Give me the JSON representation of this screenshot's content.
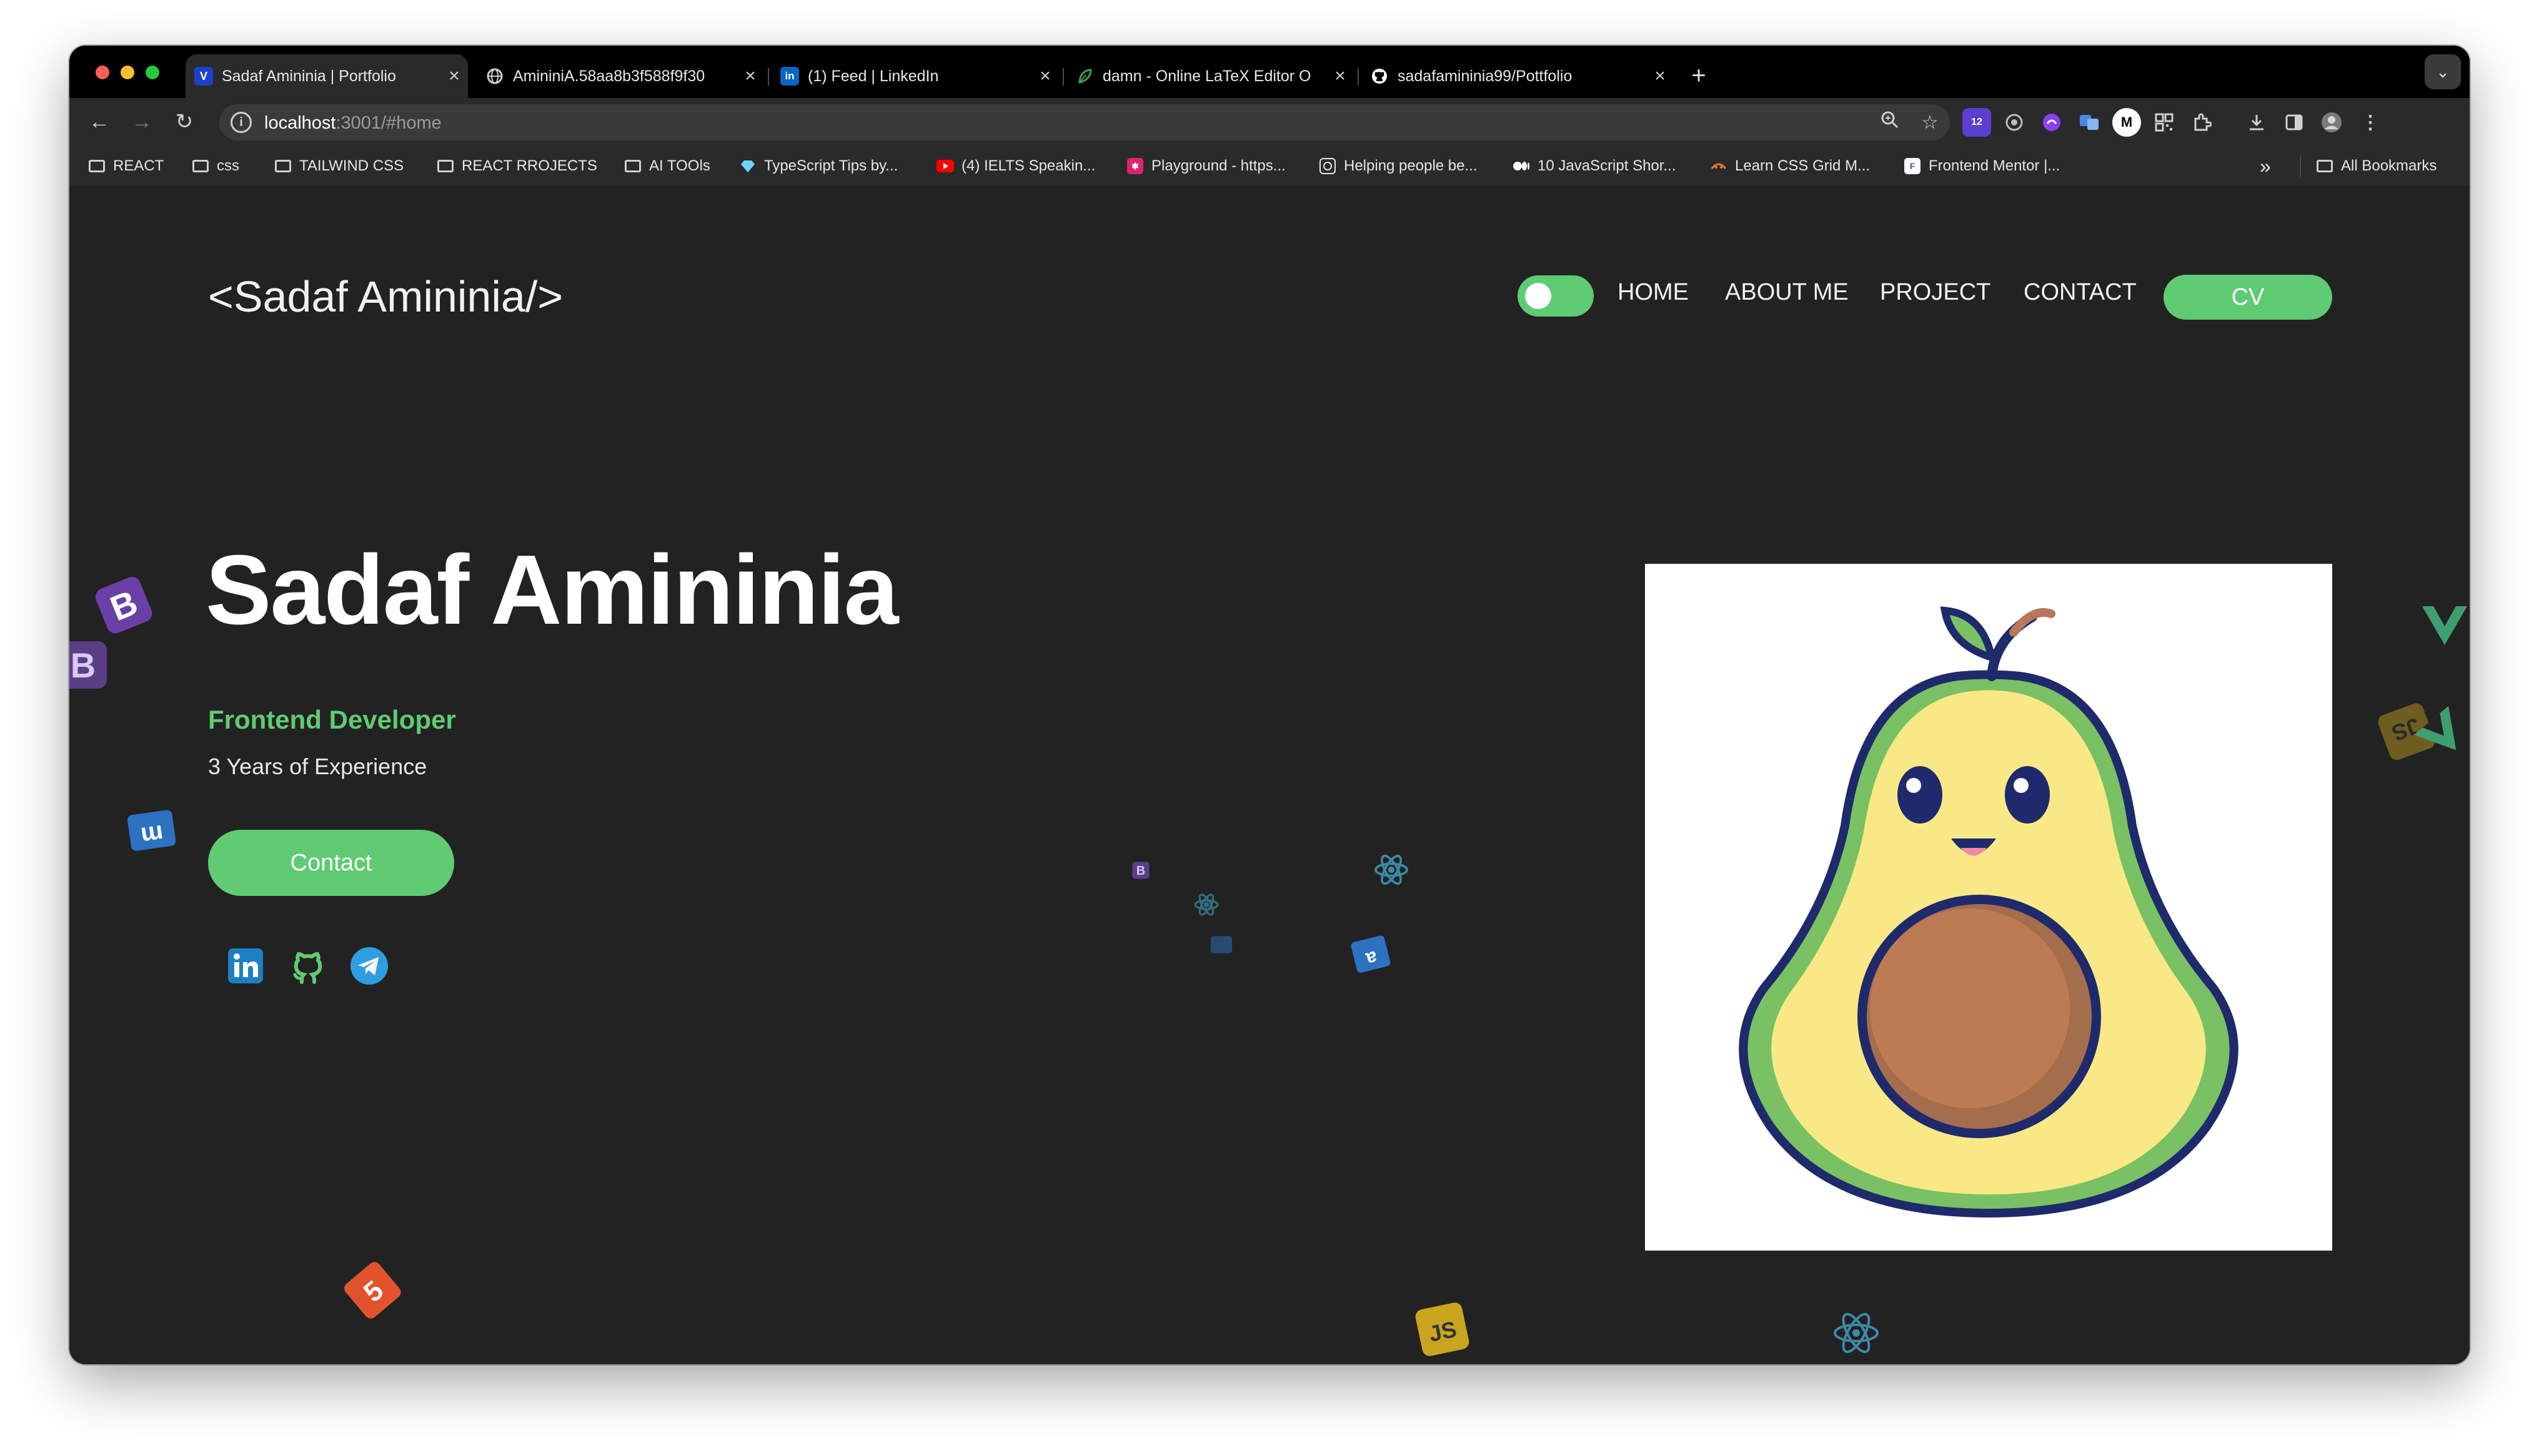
{
  "browser": {
    "tabs": [
      {
        "title": "Sadaf Amininia | Portfolio",
        "favicon": "V",
        "favicon_color": "#1e40c8",
        "active": true
      },
      {
        "title": "AmininiA.58aa8b3f588f9f30",
        "favicon": "globe-icon",
        "favicon_color": "#888888",
        "active": false
      },
      {
        "title": "(1) Feed | LinkedIn",
        "favicon": "in",
        "favicon_color": "#0a66c2",
        "active": false
      },
      {
        "title": "damn - Online LaTeX Editor O",
        "favicon": "leaf-icon",
        "favicon_color": "#3fa34d",
        "active": false
      },
      {
        "title": "sadafamininia99/Pottfolio",
        "favicon": "github-icon",
        "favicon_color": "#ffffff",
        "active": false
      }
    ],
    "url_host": "localhost",
    "url_path": ":3001/#home",
    "extension_badge": "12",
    "bookmarks": [
      {
        "label": "REACT",
        "icon": "folder-icon"
      },
      {
        "label": "css",
        "icon": "folder-icon"
      },
      {
        "label": "TAILWIND CSS",
        "icon": "folder-icon"
      },
      {
        "label": "REACT RROJECTS",
        "icon": "folder-icon"
      },
      {
        "label": "AI TOOls",
        "icon": "folder-icon"
      },
      {
        "label": "TypeScript Tips by...",
        "icon": "diamond-icon"
      },
      {
        "label": "(4) IELTS Speakin...",
        "icon": "youtube-icon"
      },
      {
        "label": "Playground - https...",
        "icon": "playground-icon"
      },
      {
        "label": "Helping people be...",
        "icon": "openai-icon"
      },
      {
        "label": "10 JavaScript Shor...",
        "icon": "medium-icon"
      },
      {
        "label": "Learn CSS Grid M...",
        "icon": "css-grid-icon"
      },
      {
        "label": "Frontend Mentor |...",
        "icon": "frontend-mentor-icon"
      }
    ],
    "overflow_label": "»",
    "all_bookmarks": "All Bookmarks"
  },
  "site": {
    "logo": "<Sadaf Amininia/>",
    "nav": [
      "HOME",
      "ABOUT ME",
      "PROJECT",
      "CONTACT"
    ],
    "cv_label": "CV",
    "theme_toggle_on": true,
    "hero": {
      "name": "Sadaf Amininia",
      "role": "Frontend Developer",
      "experience": "3 Years of Experience",
      "contact_label": "Contact"
    },
    "social": [
      "linkedin-icon",
      "github-icon",
      "telegram-icon"
    ],
    "floating_icons": [
      "bootstrap-icon",
      "css3-icon",
      "html5-icon",
      "javascript-icon",
      "react-icon",
      "vue-icon"
    ],
    "accent_color": "#5fcb73",
    "background_color": "#222222"
  }
}
